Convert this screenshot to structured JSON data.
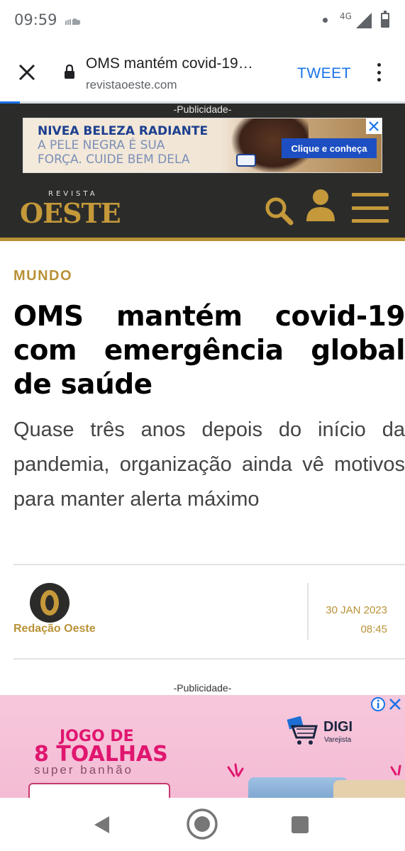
{
  "status_bar": {
    "time": "09:59",
    "network": "4G",
    "cloud_icon": "cloud-icon",
    "signal_icon": "signal-icon",
    "battery_icon": "battery-icon"
  },
  "toolbar": {
    "close_icon": "close-icon",
    "lock_icon": "lock-icon",
    "title": "OMS mantém covid-19…",
    "url": "revistaoeste.com",
    "tweet_label": "TWEET",
    "menu_icon": "more-vert-icon"
  },
  "header": {
    "publicidade_label": "-Publicidade-",
    "ad": {
      "line1": "NIVEA BELEZA RADIANTE",
      "line2": "A PELE NEGRA É SUA",
      "line3": "FORÇA. CUIDE BEM DELA",
      "cta": "Clique e conheça"
    },
    "logo": {
      "small": "REVISTA",
      "big": "OESTE"
    },
    "search_icon": "search-icon",
    "user_icon": "user-icon",
    "menu_icon": "hamburger-icon",
    "accent_color": "#c5993a",
    "background_color": "#2b2c2a"
  },
  "article": {
    "category": "MUNDO",
    "headline": "OMS mantém covid-19 com emergência global de saúde",
    "subtitle": "Quase três anos depois do início da pandemia, organização ainda vê motivos para manter alerta máximo",
    "author": "Redação Oeste",
    "date": "30 JAN 2023",
    "time": "08:45"
  },
  "bottom_ad": {
    "publicidade_label": "-Publicidade-",
    "title_line1": "JOGO DE",
    "title_line2": "8 TOALHAS",
    "title_line3": "super banhão",
    "brand": "DIGI",
    "brand_sub": "Varejista",
    "info_icon": "info-icon",
    "close_icon": "close-icon",
    "accent_color": "#e0166f"
  },
  "nav_bar": {
    "back_icon": "back-icon",
    "home_icon": "home-icon",
    "recents_icon": "recents-icon"
  }
}
